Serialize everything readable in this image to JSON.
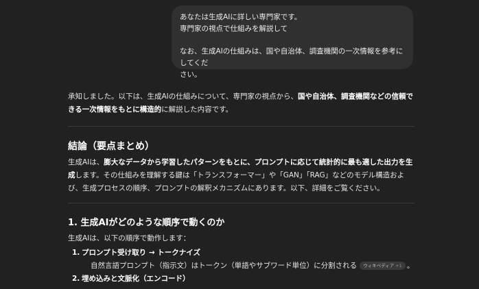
{
  "user_message": {
    "line1": "あなたは生成AIに詳しい専門家です。",
    "line2": "専門家の視点で仕組みを解説して",
    "line3": "なお、生成AIの仕組みは、国や自治体、調査機関の一次情報を参考にしてくだ",
    "line4": "さい。"
  },
  "answer": {
    "intro_part1": "承知しました。以下は、生成AIの仕組みについて、専門家の視点から、",
    "intro_bold": "国や自治体、調査機関などの信頼できる一次情報をもとに構造的",
    "intro_part2": "に解説した内容です。",
    "conclusion_heading": "結論（要点まとめ）",
    "conclusion_part1": "生成AIは、",
    "conclusion_bold1": "膨大なデータから学習したパターンをもとに、プロンプトに応じて統計的に最も適した出力を生成",
    "conclusion_part2": "します。その仕組みを理解する鍵は「トランスフォーマー」や「GAN」「RAG」などのモデル構造および、生成プロセスの順序、プロンプトの解釈メカニズムにあります。以下、詳細をご覧ください。",
    "section1_heading": "1. 生成AIがどのような順序で動くのか",
    "section1_intro": "生成AIは、以下の順序で動作します：",
    "steps": [
      {
        "num": "1.",
        "title": "プロンプト受け取り → トークナイズ",
        "desc": "自然言語プロンプト（指示文）はトークン（単語やサブワード単位）に分割される",
        "badge": "ウィキペディア",
        "badge_more": "+1",
        "after_badge": "。"
      },
      {
        "num": "2.",
        "title": "埋め込みと文脈化（エンコード）"
      }
    ]
  }
}
